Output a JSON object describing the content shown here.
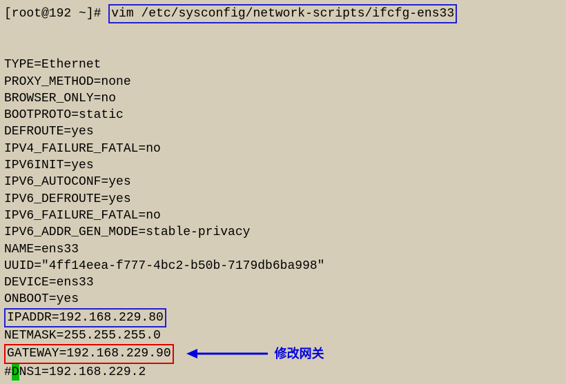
{
  "prompt": "[root@192 ~]# ",
  "command": "vim /etc/sysconfig/network-scripts/ifcfg-ens33",
  "config": {
    "type": "TYPE=Ethernet",
    "proxy_method": "PROXY_METHOD=none",
    "browser_only": "BROWSER_ONLY=no",
    "bootproto": "BOOTPROTO=static",
    "defroute": "DEFROUTE=yes",
    "ipv4_failure": "IPV4_FAILURE_FATAL=no",
    "ipv6init": "IPV6INIT=yes",
    "ipv6_autoconf": "IPV6_AUTOCONF=yes",
    "ipv6_defroute": "IPV6_DEFROUTE=yes",
    "ipv6_failure": "IPV6_FAILURE_FATAL=no",
    "ipv6_addr_gen": "IPV6_ADDR_GEN_MODE=stable-privacy",
    "name": "NAME=ens33",
    "uuid": "UUID=\"4ff14eea-f777-4bc2-b50b-7179db6ba998\"",
    "device": "DEVICE=ens33",
    "onboot": "ONBOOT=yes",
    "ipaddr": "IPADDR=192.168.229.80",
    "netmask": "NETMASK=255.255.255.0",
    "gateway": "GATEWAY=192.168.229.90",
    "dns_prefix": "#",
    "dns_cursor": "D",
    "dns_suffix": "NS1=192.168.229.2"
  },
  "annotation_text": "修改网关"
}
